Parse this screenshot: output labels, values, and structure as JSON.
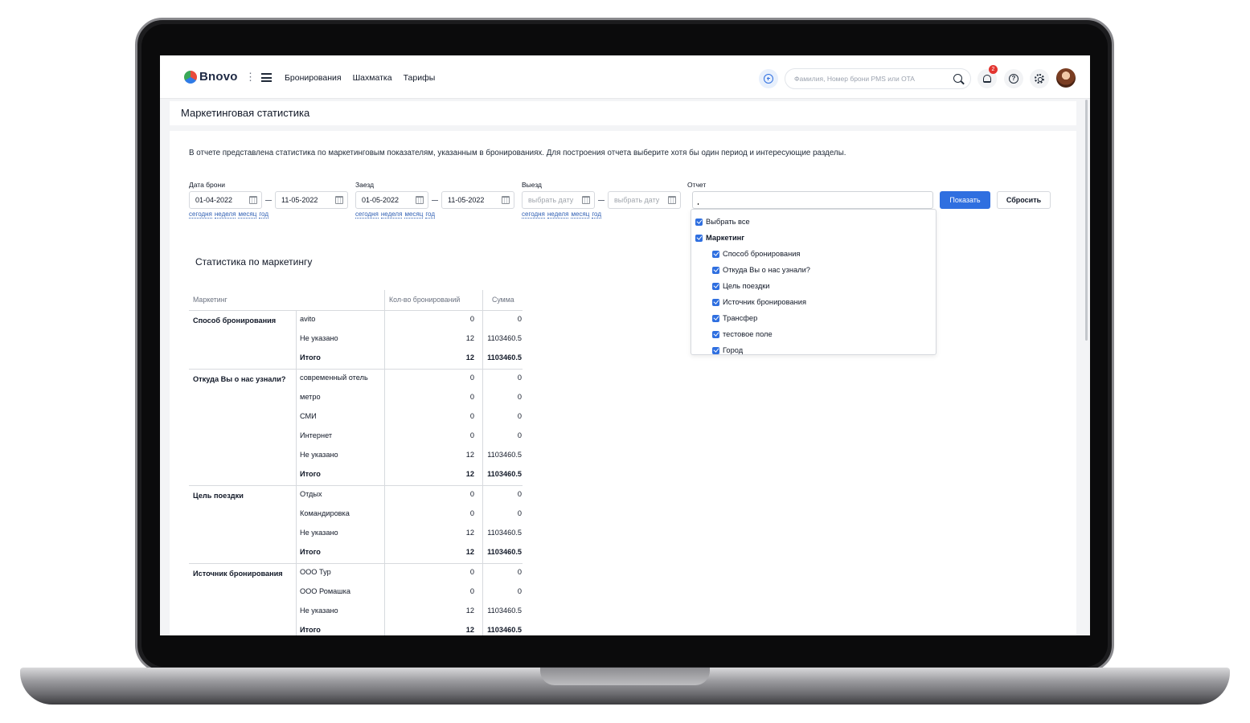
{
  "app": {
    "logo_text": "Bnovo"
  },
  "nav": [
    "Бронирования",
    "Шахматка",
    "Тарифы"
  ],
  "search": {
    "placeholder": "Фамилия, Номер брони PMS или OTA"
  },
  "notifications": {
    "count": "2"
  },
  "help_icon_glyph": "?",
  "page_title": "Маркетинговая статистика",
  "intro": "В отчете представлена статистика по маркетинговым показателям, указанным в бронированиях. Для построения отчета выберите хотя бы один период и интересующие разделы.",
  "filters": {
    "booking_date": {
      "label": "Дата брони",
      "from": "01-04-2022",
      "to": "11-05-2022"
    },
    "checkin": {
      "label": "Заезд",
      "from": "01-05-2022",
      "to": "11-05-2022"
    },
    "checkout": {
      "label": "Выезд",
      "from_placeholder": "выбрать дату",
      "to_placeholder": "выбрать дату"
    },
    "quick_links": [
      "сегодня",
      "неделя",
      "месяц",
      "год"
    ],
    "report": {
      "label": "Отчет",
      "value": "",
      "options": [
        {
          "label": "Выбрать все",
          "checked": true,
          "level": 0,
          "bold": false
        },
        {
          "label": "Маркетинг",
          "checked": true,
          "level": 0,
          "bold": true
        },
        {
          "label": "Способ бронирования",
          "checked": true,
          "level": 1,
          "bold": false
        },
        {
          "label": "Откуда Вы о нас узнали?",
          "checked": true,
          "level": 1,
          "bold": false
        },
        {
          "label": "Цель поездки",
          "checked": true,
          "level": 1,
          "bold": false
        },
        {
          "label": "Источник бронирования",
          "checked": true,
          "level": 1,
          "bold": false
        },
        {
          "label": "Трансфер",
          "checked": true,
          "level": 1,
          "bold": false
        },
        {
          "label": "тестовое поле",
          "checked": true,
          "level": 1,
          "bold": false
        },
        {
          "label": "Город",
          "checked": true,
          "level": 1,
          "bold": false
        }
      ]
    },
    "show_button": "Показать",
    "reset_button": "Сбросить"
  },
  "stats": {
    "title": "Статистика по маркетингу",
    "headers": [
      "Маркетинг",
      "Кол-во бронирований",
      "Сумма"
    ],
    "groups": [
      {
        "name": "Способ бронирования",
        "rows": [
          {
            "label": "avito",
            "count": "0",
            "sum": "0"
          },
          {
            "label": "Не указано",
            "count": "12",
            "sum": "1103460.5"
          },
          {
            "label": "Итого",
            "count": "12",
            "sum": "1103460.5",
            "total": true
          }
        ]
      },
      {
        "name": "Откуда Вы о нас узнали?",
        "rows": [
          {
            "label": "современный отель",
            "count": "0",
            "sum": "0"
          },
          {
            "label": "метро",
            "count": "0",
            "sum": "0"
          },
          {
            "label": "СМИ",
            "count": "0",
            "sum": "0"
          },
          {
            "label": "Интернет",
            "count": "0",
            "sum": "0"
          },
          {
            "label": "Не указано",
            "count": "12",
            "sum": "1103460.5"
          },
          {
            "label": "Итого",
            "count": "12",
            "sum": "1103460.5",
            "total": true
          }
        ]
      },
      {
        "name": "Цель поездки",
        "rows": [
          {
            "label": "Отдых",
            "count": "0",
            "sum": "0"
          },
          {
            "label": "Командировка",
            "count": "0",
            "sum": "0"
          },
          {
            "label": "Не указано",
            "count": "12",
            "sum": "1103460.5"
          },
          {
            "label": "Итого",
            "count": "12",
            "sum": "1103460.5",
            "total": true
          }
        ]
      },
      {
        "name": "Источник бронирования",
        "rows": [
          {
            "label": "ООО Тур",
            "count": "0",
            "sum": "0"
          },
          {
            "label": "ООО Ромашка",
            "count": "0",
            "sum": "0"
          },
          {
            "label": "Не указано",
            "count": "12",
            "sum": "1103460.5"
          },
          {
            "label": "Итого",
            "count": "12",
            "sum": "1103460.5",
            "total": true
          }
        ]
      }
    ]
  }
}
